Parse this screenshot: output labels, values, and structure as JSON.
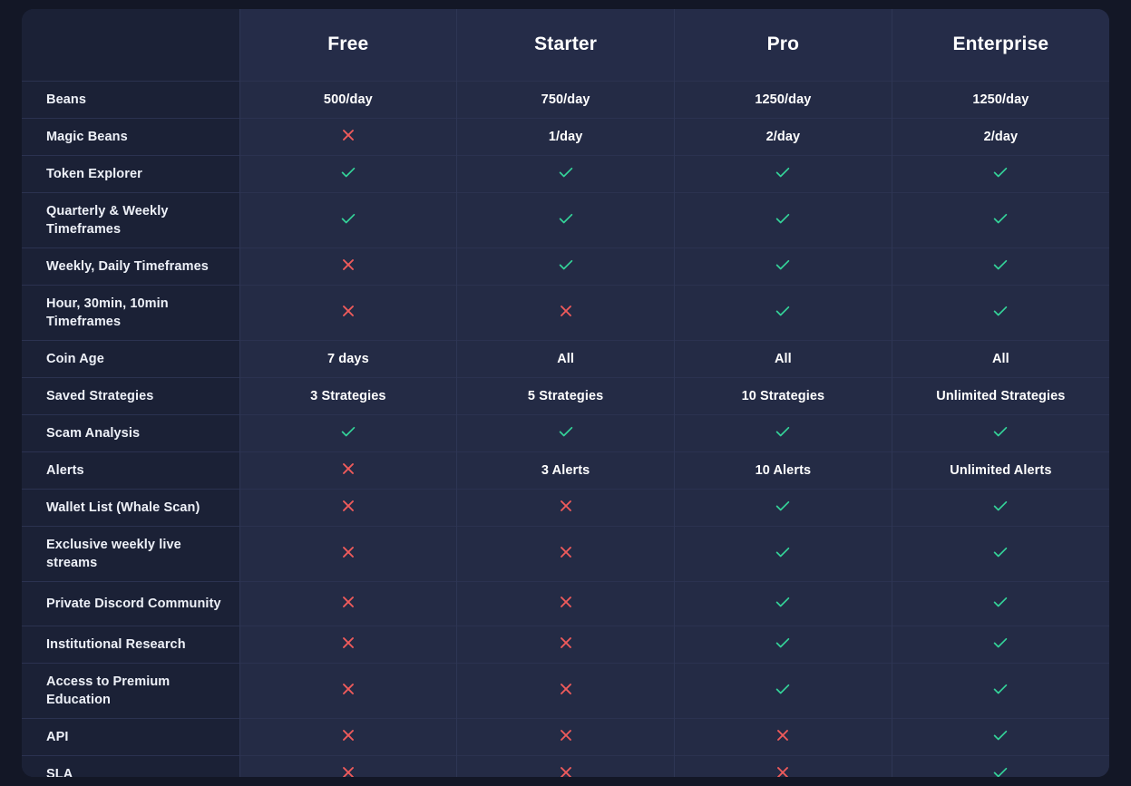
{
  "table": {
    "label_column_header": "",
    "plans": [
      "Free",
      "Starter",
      "Pro",
      "Enterprise"
    ],
    "colors": {
      "page_background": "#131726",
      "label_column_background": "#1b2136",
      "value_column_background": "#242b45",
      "header_background": "#252c48",
      "border": "#2e3654",
      "check": "#34d399",
      "cross": "#ef5b5b",
      "text": "#ffffff"
    },
    "icons": {
      "check": "check-icon",
      "cross": "cross-icon"
    },
    "rows": [
      {
        "feature": "Beans",
        "values": [
          "500/day",
          "750/day",
          "1250/day",
          "1250/day"
        ]
      },
      {
        "feature": "Magic Beans",
        "values": [
          "cross",
          "1/day",
          "2/day",
          "2/day"
        ]
      },
      {
        "feature": "Token Explorer",
        "values": [
          "check",
          "check",
          "check",
          "check"
        ]
      },
      {
        "feature": "Quarterly & Weekly Timeframes",
        "values": [
          "check",
          "check",
          "check",
          "check"
        ]
      },
      {
        "feature": "Weekly, Daily Timeframes",
        "values": [
          "cross",
          "check",
          "check",
          "check"
        ]
      },
      {
        "feature": "Hour, 30min, 10min Timeframes",
        "values": [
          "cross",
          "cross",
          "check",
          "check"
        ]
      },
      {
        "feature": "Coin Age",
        "values": [
          "7 days",
          "All",
          "All",
          "All"
        ]
      },
      {
        "feature": "Saved Strategies",
        "values": [
          "3 Strategies",
          "5 Strategies",
          "10 Strategies",
          "Unlimited Strategies"
        ]
      },
      {
        "feature": "Scam Analysis",
        "values": [
          "check",
          "check",
          "check",
          "check"
        ]
      },
      {
        "feature": "Alerts",
        "values": [
          "cross",
          "3 Alerts",
          "10 Alerts",
          "Unlimited Alerts"
        ]
      },
      {
        "feature": "Wallet List (Whale Scan)",
        "values": [
          "cross",
          "cross",
          "check",
          "check"
        ]
      },
      {
        "feature": "Exclusive weekly live streams",
        "values": [
          "cross",
          "cross",
          "check",
          "check"
        ]
      },
      {
        "feature": "Private Discord Community",
        "values": [
          "cross",
          "cross",
          "check",
          "check"
        ]
      },
      {
        "feature": "Institutional Research",
        "values": [
          "cross",
          "cross",
          "check",
          "check"
        ]
      },
      {
        "feature": "Access to Premium Education",
        "values": [
          "cross",
          "cross",
          "check",
          "check"
        ]
      },
      {
        "feature": "API",
        "values": [
          "cross",
          "cross",
          "cross",
          "check"
        ]
      },
      {
        "feature": "SLA",
        "values": [
          "cross",
          "cross",
          "cross",
          "check"
        ]
      }
    ]
  }
}
